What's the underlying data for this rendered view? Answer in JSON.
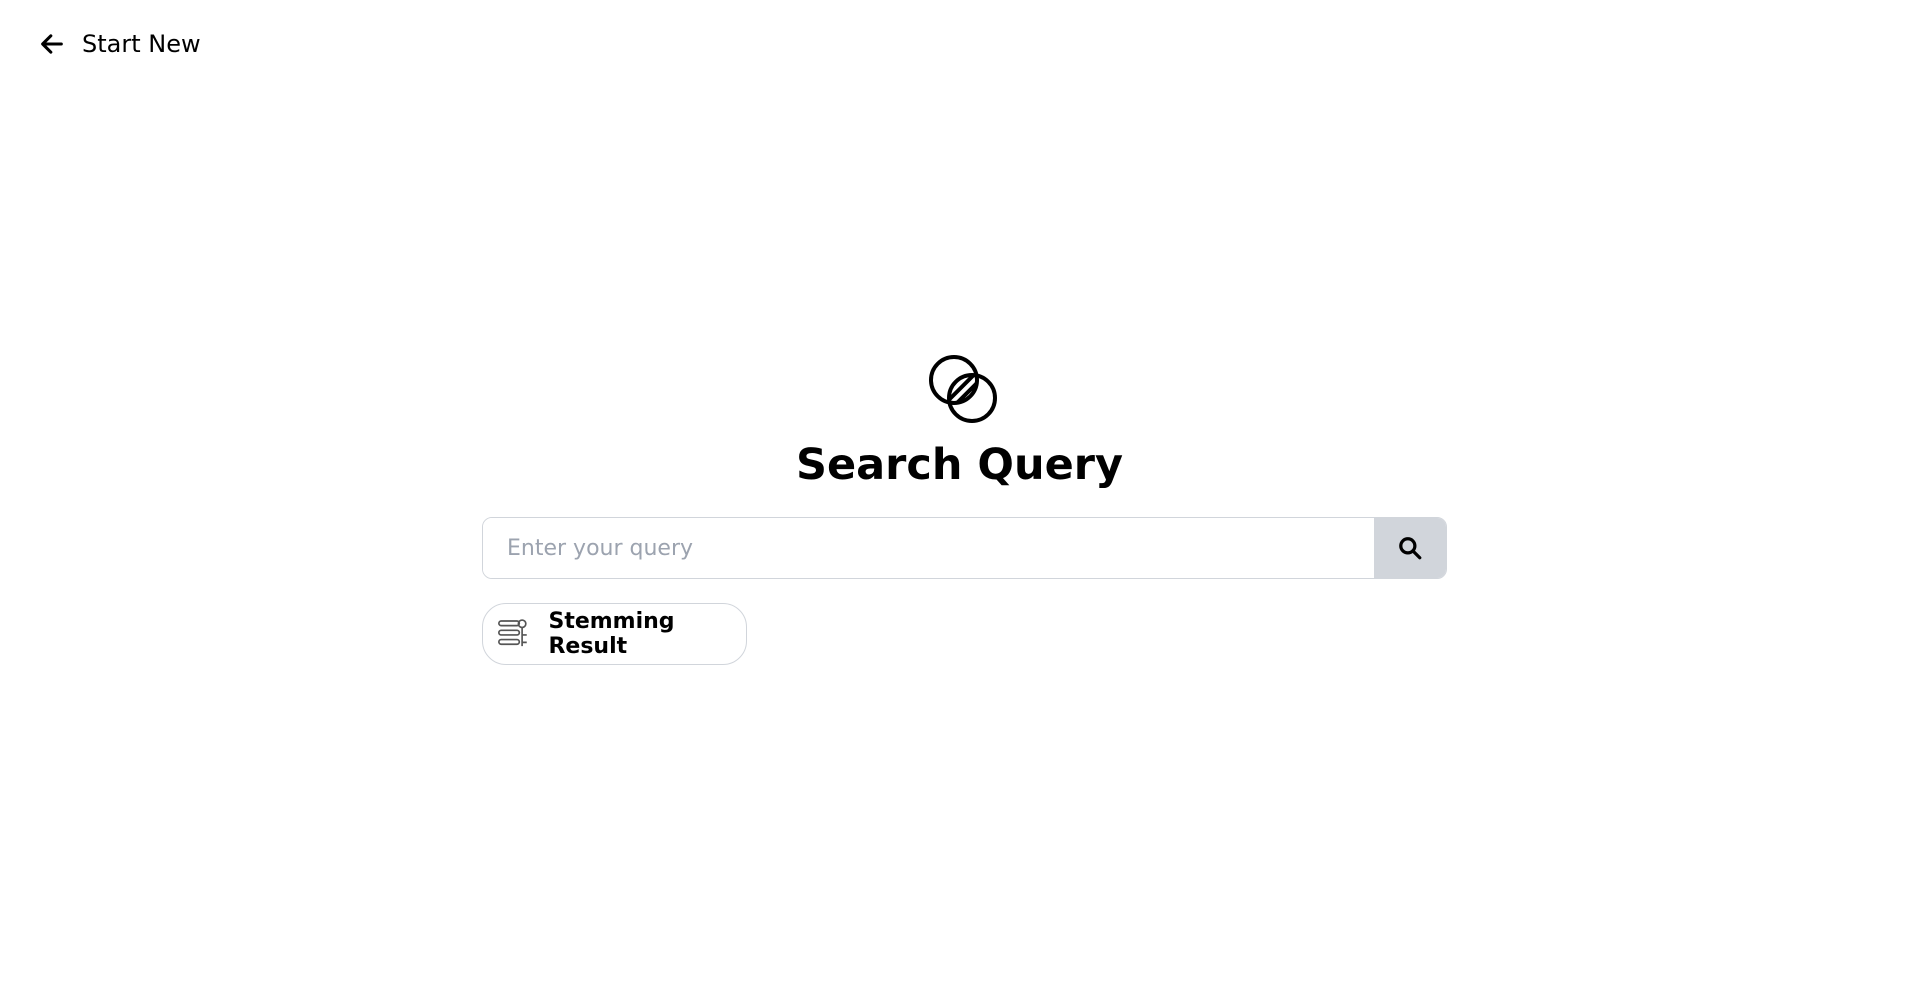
{
  "nav": {
    "back_label": "Start New"
  },
  "main": {
    "title": "Search Query",
    "search": {
      "placeholder": "Enter your query",
      "value": ""
    },
    "stemming_label": "Stemming Result"
  }
}
